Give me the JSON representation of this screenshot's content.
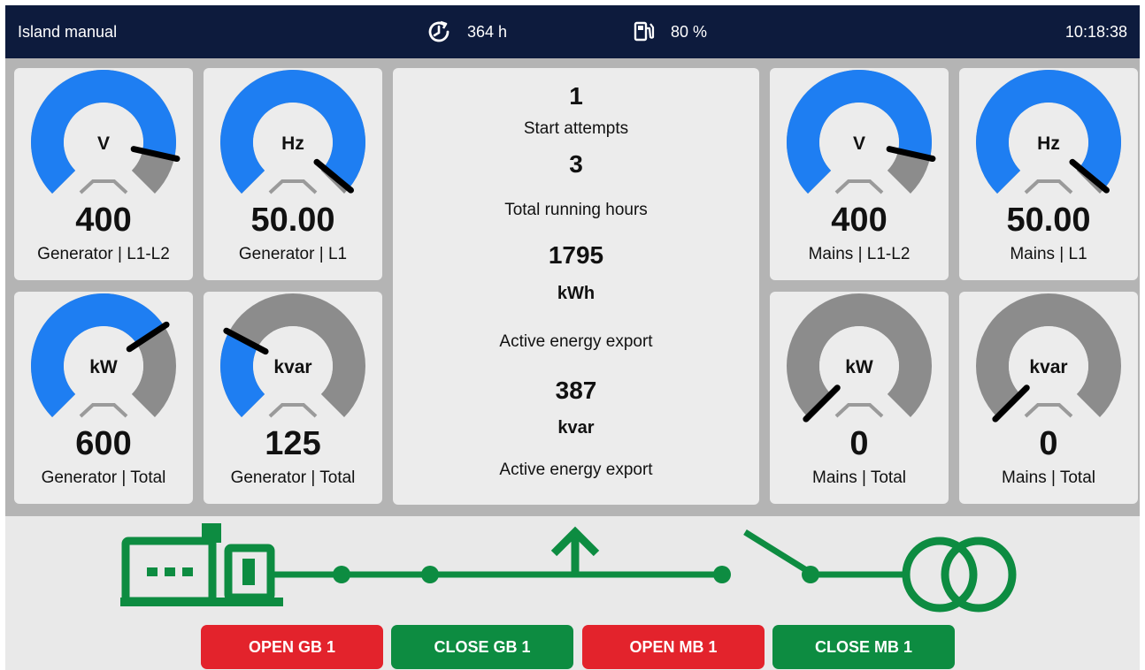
{
  "topbar": {
    "mode": "Island manual",
    "running_hours": "364 h",
    "fuel_level": "80 %",
    "clock": "10:18:38",
    "icons": {
      "hours": "clock-refresh-icon",
      "fuel": "fuel-pump-icon"
    }
  },
  "colors": {
    "topbar_bg": "#0d1b3d",
    "gauge_active": "#1e7ef2",
    "gauge_inactive": "#8c8c8c",
    "line_green": "#0d8c41",
    "button_open": "#e3232c",
    "button_close": "#0d8c41"
  },
  "gauges": [
    {
      "id": "gen-voltage",
      "unit": "V",
      "value": "400",
      "label": "Generator | L1-L2",
      "fill": 0.88
    },
    {
      "id": "gen-frequency",
      "unit": "Hz",
      "value": "50.00",
      "label": "Generator | L1",
      "fill": 0.98
    },
    {
      "id": "gen-power",
      "unit": "kW",
      "value": "600",
      "label": "Generator | Total",
      "fill": 0.71
    },
    {
      "id": "gen-reactive",
      "unit": "kvar",
      "value": "125",
      "label": "Generator | Total",
      "fill": 0.27
    },
    {
      "id": "mains-voltage",
      "unit": "V",
      "value": "400",
      "label": "Mains | L1-L2",
      "fill": 0.88
    },
    {
      "id": "mains-frequency",
      "unit": "Hz",
      "value": "50.00",
      "label": "Mains | L1",
      "fill": 0.98
    },
    {
      "id": "mains-power",
      "unit": "kW",
      "value": "0",
      "label": "Mains | Total",
      "fill": 0
    },
    {
      "id": "mains-reactive",
      "unit": "kvar",
      "value": "0",
      "label": "Mains | Total",
      "fill": 0
    }
  ],
  "center": {
    "start_attempts_value": "1",
    "start_attempts_label": "Start attempts",
    "running_hours_value": "3",
    "running_hours_label": "Total running hours",
    "active_energy_value": "1795",
    "active_energy_unit": "kWh",
    "active_energy_label": "Active energy export",
    "reactive_energy_value": "387",
    "reactive_energy_unit": "kvar",
    "reactive_energy_label": "Active energy export"
  },
  "diagram": {
    "generator_icon": "generator-icon",
    "transformer_icon": "transformer-icon",
    "breaker_gb_state": "closed",
    "breaker_mb_state": "open"
  },
  "buttons": {
    "open_gb": "OPEN GB 1",
    "close_gb": "CLOSE GB 1",
    "open_mb": "OPEN MB 1",
    "close_mb": "CLOSE MB 1"
  }
}
